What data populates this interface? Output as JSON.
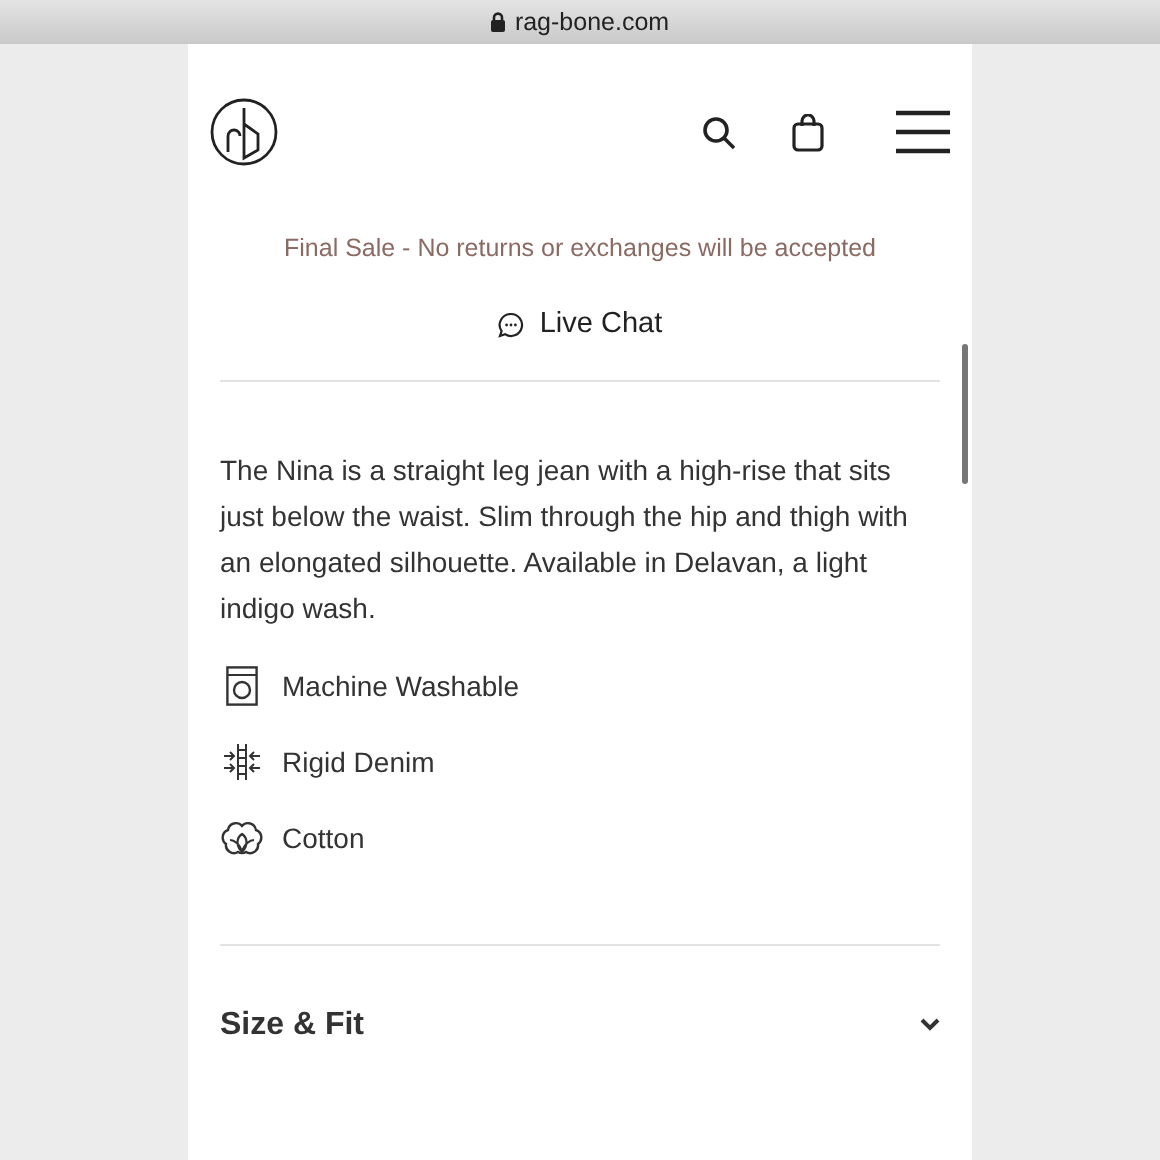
{
  "address_bar": {
    "url": "rag-bone.com"
  },
  "notice": "Final Sale - No returns or exchanges will be accepted",
  "live_chat": "Live Chat",
  "description": "The Nina is a straight leg jean with a high-rise that sits just below the waist. Slim through the hip and thigh with an elongated silhouette. Available in Delavan, a light indigo wash.",
  "features": [
    {
      "kind": "washer",
      "label": "Machine Washable"
    },
    {
      "kind": "denim",
      "label": "Rigid Denim"
    },
    {
      "kind": "cotton",
      "label": "Cotton"
    }
  ],
  "sections": [
    {
      "title": "Size & Fit",
      "expanded": false
    }
  ]
}
